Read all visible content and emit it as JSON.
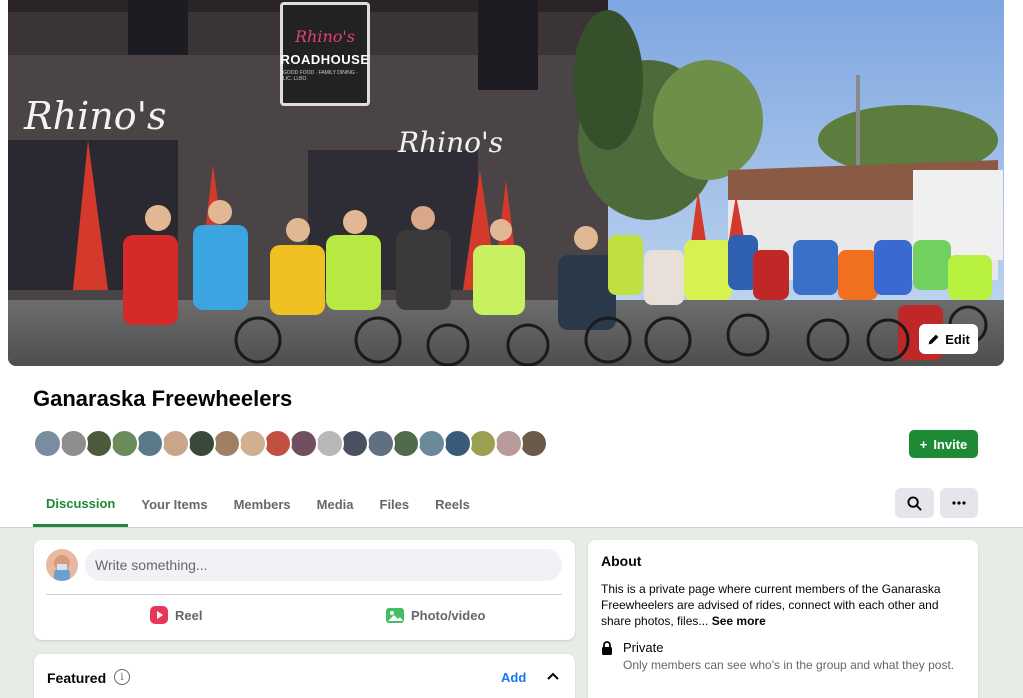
{
  "cover": {
    "sign_left": "Rhino's",
    "sign_center": "Rhino's",
    "roadhouse_logo": "Rhino's",
    "roadhouse_name": "ROADHOUSE",
    "roadhouse_small": "GOOD FOOD · FAMILY DINING · LIC. LLBO",
    "edit_label": "Edit"
  },
  "header": {
    "group_name": "Ganaraska Freewheelers",
    "invite_label": "Invite",
    "member_avatar_colors": [
      "#7a8ca0",
      "#8e8e8e",
      "#4a5a3a",
      "#6b8b5a",
      "#5a7a8a",
      "#c9a58a",
      "#3a4a3a",
      "#a08060",
      "#d0b090",
      "#c05040",
      "#705060",
      "#b8b8b8",
      "#4a5060",
      "#607080",
      "#506a4a",
      "#6a8a9a",
      "#3a5a7a",
      "#9aa050",
      "#b89a9a",
      "#6a5a4a"
    ]
  },
  "tabs": [
    {
      "label": "Discussion",
      "active": true
    },
    {
      "label": "Your Items",
      "active": false
    },
    {
      "label": "Members",
      "active": false
    },
    {
      "label": "Media",
      "active": false
    },
    {
      "label": "Files",
      "active": false
    },
    {
      "label": "Reels",
      "active": false
    }
  ],
  "tab_icons": {
    "search": "search-icon",
    "more": "more-icon"
  },
  "composer": {
    "placeholder": "Write something...",
    "reel_label": "Reel",
    "photo_label": "Photo/video"
  },
  "featured": {
    "title": "Featured",
    "info_glyph": "i",
    "add_label": "Add"
  },
  "about": {
    "title": "About",
    "description": "This is a private page where current members of the Ganaraska Freewheelers are advised of rides, connect with each other and share photos, files...",
    "see_more": "See more",
    "privacy_title": "Private",
    "privacy_desc": "Only members can see who's in the group and what they post."
  },
  "colors": {
    "accent": "#1e8a35",
    "link": "#1877f2",
    "content_bg": "#e6ede6"
  }
}
